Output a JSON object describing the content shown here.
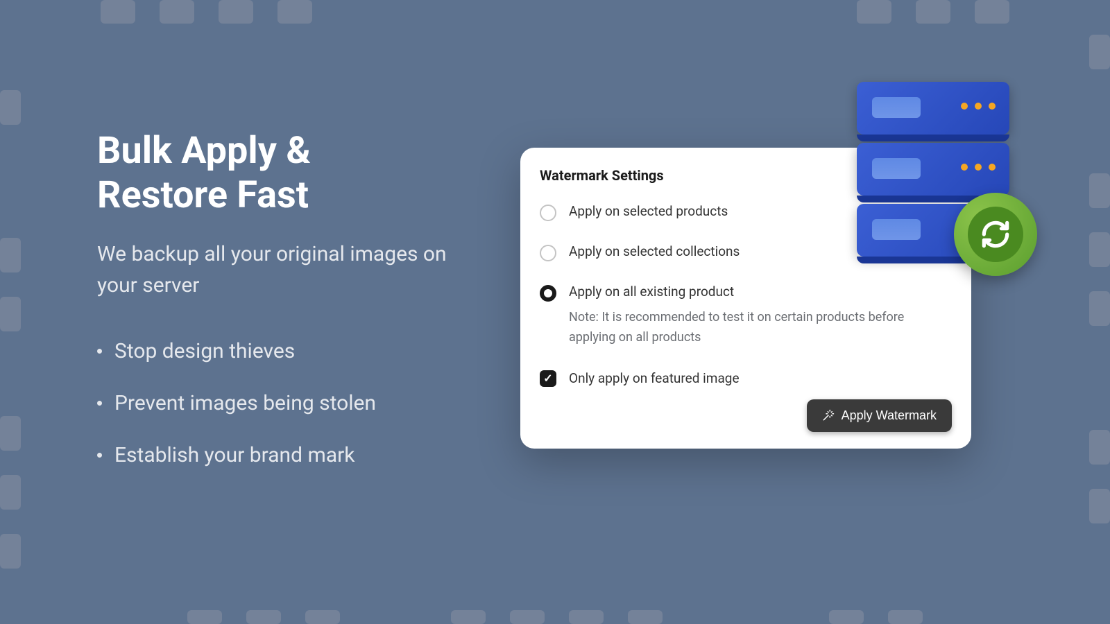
{
  "hero": {
    "headline_line1": "Bulk Apply &",
    "headline_line2": "Restore Fast",
    "subheadline": "We backup all your original images on your server",
    "bullets": [
      "Stop design thieves",
      "Prevent images being stolen",
      "Establish your brand mark"
    ]
  },
  "settings": {
    "title": "Watermark Settings",
    "options": [
      {
        "label": "Apply on selected products",
        "selected": false
      },
      {
        "label": "Apply on selected collections",
        "selected": false
      },
      {
        "label": "Apply on all existing product",
        "selected": true,
        "note": "Note: It is recommended to test it on certain products before applying on all products"
      }
    ],
    "checkbox": {
      "label": "Only apply on featured image",
      "checked": true
    },
    "button_label": "Apply Watermark"
  }
}
